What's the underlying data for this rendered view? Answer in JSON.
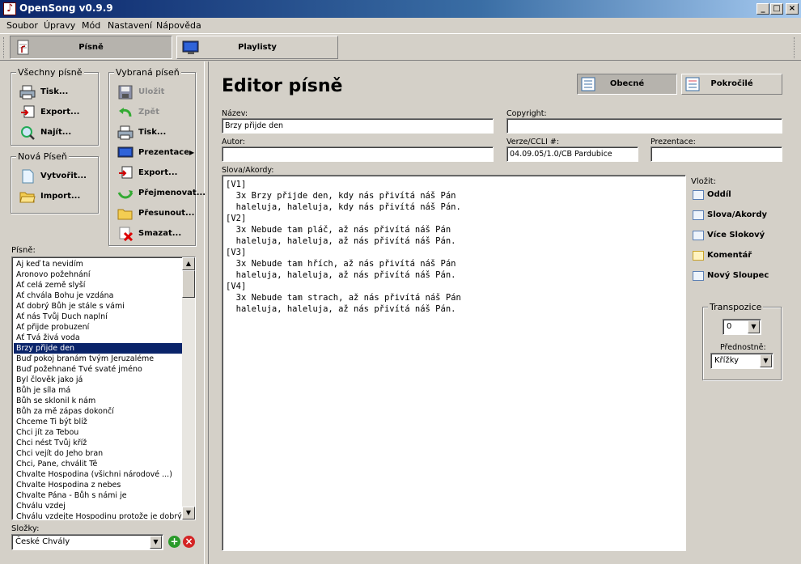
{
  "window": {
    "title": "OpenSong v0.9.9"
  },
  "menu": [
    "Soubor",
    "Úpravy",
    "Mód",
    "Nastavení",
    "Nápověda"
  ],
  "main_tabs": {
    "songs": "Písně",
    "playlists": "Playlisty"
  },
  "all_songs_group": {
    "title": "Všechny písně",
    "print": "Tisk...",
    "export": "Export...",
    "find": "Najít..."
  },
  "new_song_group": {
    "title": "Nová Píseň",
    "create": "Vytvořit...",
    "import": "Import..."
  },
  "selected_song_group": {
    "title": "Vybraná píseň",
    "save": "Uložit",
    "undo": "Zpět",
    "print": "Tisk...",
    "present": "Prezentace",
    "export": "Export...",
    "rename": "Přejmenovat...",
    "move": "Přesunout...",
    "delete": "Smazat..."
  },
  "songs_label": "Písně:",
  "songs": [
    "Aj keď ta nevidím",
    "Aronovo požehnání",
    "Ať celá země slyší",
    "Ať chvála Bohu je vzdána",
    "Ať dobrý Bůh je stále s vámi",
    "Ať nás Tvůj Duch naplní",
    "Ať přijde probuzení",
    "Ať Tvá živá voda",
    "Brzy přijde den",
    "Buď pokoj branám tvým Jeruzaléme",
    "Buď požehnané Tvé svaté jméno",
    "Byl člověk jako já",
    "Bůh je síla má",
    "Bůh se sklonil k nám",
    "Bůh za mě zápas dokončí",
    "Chceme Ti být blíž",
    "Chci jít za Tebou",
    "Chci nést Tvůj kříž",
    "Chci vejít do Jeho bran",
    "Chci, Pane, chválit Tě",
    "Chvalte Hospodina (všichni národové ...)",
    "Chvalte Hospodina z nebes",
    "Chvalte Pána - Bůh s námi je",
    "Chválu vzdej",
    "Chválu vzdejte Hospodinu protože je dobrý"
  ],
  "selected_song_index": 8,
  "folders_label": "Složky:",
  "folder_selected": "České Chvály",
  "editor": {
    "title": "Editor písně",
    "tab_general": "Obecné",
    "tab_advanced": "Pokročilé",
    "name_label": "Název:",
    "name_value": "Brzy přijde den",
    "copyright_label": "Copyright:",
    "copyright_value": "",
    "author_label": "Autor:",
    "author_value": "",
    "ccli_label": "Verze/CCLI #:",
    "ccli_value": "04.09.05/1.0/CB Pardubice",
    "presentation_label": "Prezentace:",
    "presentation_value": "",
    "lyrics_label": "Slova/Akordy:",
    "lyrics": "[V1]\n  3x Brzy přijde den, kdy nás přivítá náš Pán\n  haleluja, haleluja, kdy nás přivítá náš Pán.\n[V2]\n  3x Nebude tam pláč, až nás přivítá náš Pán\n  haleluja, haleluja, až nás přivítá náš Pán.\n[V3]\n  3x Nebude tam hřích, až nás přivítá náš Pán\n  haleluja, haleluja, až nás přivítá náš Pán.\n[V4]\n  3x Nebude tam strach, až nás přivítá náš Pán\n  haleluja, haleluja, až nás přivítá náš Pán."
  },
  "insert": {
    "label": "Vložit:",
    "section": "Oddíl",
    "words_chords": "Slova/Akordy",
    "more_verses": "Více Slokový",
    "comment": "Komentář",
    "new_column": "Nový Sloupec"
  },
  "transpose": {
    "title": "Transpozice",
    "value": "0",
    "preference_label": "Přednostně:",
    "preference_value": "Křížky"
  },
  "colors": {
    "selection": "#0a246a",
    "titlebar": "#0a246a"
  }
}
